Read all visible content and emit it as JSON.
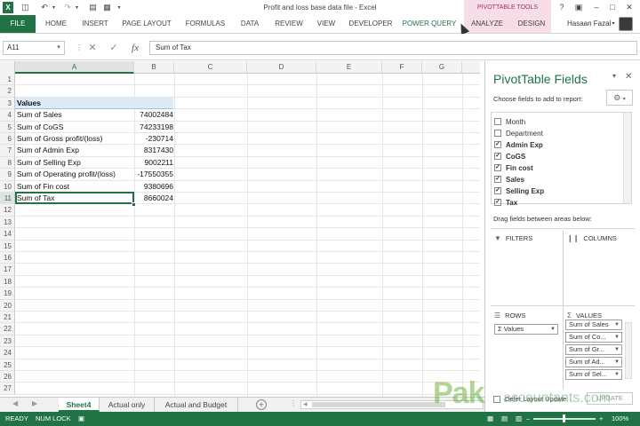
{
  "window": {
    "title": "Profit and loss base data file - Excel",
    "context_group": "PIVOTTABLE TOOLS",
    "user": "Hasaan Fazal"
  },
  "ribbon": {
    "tabs": [
      "FILE",
      "HOME",
      "INSERT",
      "PAGE LAYOUT",
      "FORMULAS",
      "DATA",
      "REVIEW",
      "VIEW",
      "DEVELOPER",
      "POWER QUERY",
      "ANALYZE",
      "DESIGN"
    ]
  },
  "formula_bar": {
    "name_box": "A11",
    "formula": "Sum of Tax",
    "fx": "fx",
    "cancel": "✕",
    "enter": "✓"
  },
  "grid": {
    "columns": [
      "A",
      "B",
      "C",
      "D",
      "E",
      "F",
      "G"
    ],
    "row_numbers": [
      "1",
      "2",
      "3",
      "4",
      "5",
      "6",
      "7",
      "8",
      "9",
      "10",
      "11",
      "12",
      "13",
      "14",
      "15",
      "16",
      "17",
      "18",
      "19",
      "20",
      "21",
      "22",
      "23",
      "24",
      "25",
      "26",
      "27"
    ],
    "header_row": {
      "row": "3",
      "label": "Values"
    },
    "rows": [
      {
        "a": "Sum of Sales",
        "b": "74002484"
      },
      {
        "a": "Sum of CoGS",
        "b": "74233198"
      },
      {
        "a": "Sum of Gross profit/(loss)",
        "b": "-230714"
      },
      {
        "a": "Sum of Admin Exp",
        "b": "8317430"
      },
      {
        "a": "Sum of Selling Exp",
        "b": "9002211"
      },
      {
        "a": "Sum of Operating profit/(loss)",
        "b": "-17550355"
      },
      {
        "a": "Sum of Fin cost",
        "b": "9380696"
      },
      {
        "a": "Sum of Tax",
        "b": "8660024"
      }
    ],
    "selected_cell": "A11"
  },
  "sheets": {
    "tabs": [
      "Sheet4",
      "Actual only",
      "Actual and Budget"
    ],
    "active": "Sheet4",
    "add": "+"
  },
  "status": {
    "ready": "READY",
    "numlock": "NUM LOCK",
    "zoom": "100%"
  },
  "pivot_pane": {
    "title": "PivotTable Fields",
    "subtitle": "Choose fields to add to report:",
    "fields": [
      {
        "name": "Month",
        "checked": false
      },
      {
        "name": "Department",
        "checked": false
      },
      {
        "name": "Admin Exp",
        "checked": true
      },
      {
        "name": "CoGS",
        "checked": true
      },
      {
        "name": "Fin cost",
        "checked": true
      },
      {
        "name": "Sales",
        "checked": true
      },
      {
        "name": "Selling Exp",
        "checked": true
      },
      {
        "name": "Tax",
        "checked": true
      }
    ],
    "drag_msg": "Drag fields between areas below:",
    "areas": {
      "filters": "FILTERS",
      "columns": "COLUMNS",
      "rows": "ROWS",
      "values": "VALUES"
    },
    "rows_items": [
      "Values"
    ],
    "values_items": [
      "Sum of Sales",
      "Sum of Co...",
      "Sum of Gr...",
      "Sum of Ad...",
      "Sum of Sel..."
    ],
    "defer": "Defer Layout Update",
    "update": "UPDATE"
  },
  "watermark": {
    "brand": "Pak",
    "brand_rest": "accountants.com"
  },
  "colors": {
    "excel_green": "#217346",
    "context_pink": "#f6dde8",
    "values_band": "#ddebf7"
  }
}
